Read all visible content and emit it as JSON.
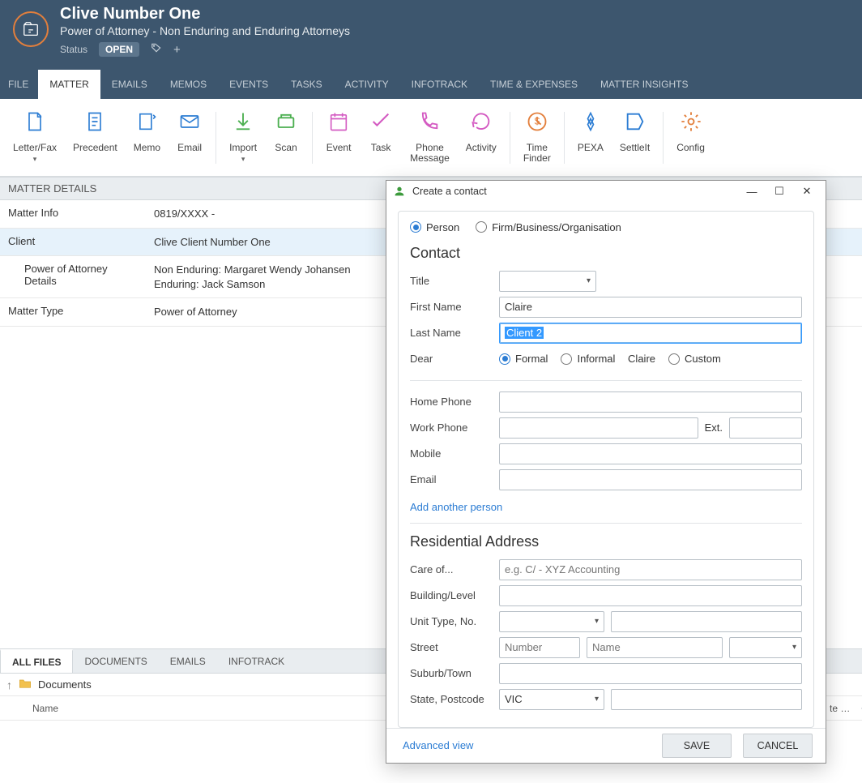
{
  "header": {
    "title": "Clive Number One",
    "subtitle": "Power of Attorney - Non Enduring and Enduring Attorneys",
    "status_label": "Status",
    "status_badge": "OPEN"
  },
  "menu_tabs": [
    "FILE",
    "MATTER",
    "EMAILS",
    "MEMOS",
    "EVENTS",
    "TASKS",
    "ACTIVITY",
    "INFOTRACK",
    "TIME & EXPENSES",
    "MATTER INSIGHTS"
  ],
  "menu_active_index": 1,
  "ribbon": [
    "Letter/Fax",
    "Precedent",
    "Memo",
    "Email",
    "Import",
    "Scan",
    "Event",
    "Task",
    "Phone\nMessage",
    "Activity",
    "Time\nFinder",
    "PEXA",
    "SettleIt",
    "Config"
  ],
  "details_heading": "MATTER DETAILS",
  "details": {
    "rows": [
      {
        "label": "Matter Info",
        "value": "0819/XXXX -",
        "indent": false,
        "selected": false
      },
      {
        "label": "Client",
        "value": "Clive Client Number One",
        "indent": false,
        "selected": true
      },
      {
        "label": "Power of Attorney Details",
        "value": "Non Enduring: Margaret Wendy Johansen\nEnduring: Jack Samson",
        "indent": true,
        "selected": false
      },
      {
        "label": "Matter Type",
        "value": "Power of Attorney",
        "indent": false,
        "selected": false
      }
    ]
  },
  "bottom": {
    "tabs": [
      "ALL FILES",
      "DOCUMENTS",
      "EMAILS",
      "INFOTRACK"
    ],
    "active_index": 0,
    "path": "Documents",
    "col_name": "Name",
    "col_right": "te m..."
  },
  "dialog": {
    "title": "Create a contact",
    "type_options": {
      "person": "Person",
      "firm": "Firm/Business/Organisation"
    },
    "type_selected": "person",
    "contact_heading": "Contact",
    "labels": {
      "title": "Title",
      "first_name": "First Name",
      "last_name": "Last Name",
      "dear": "Dear",
      "home_phone": "Home Phone",
      "work_phone": "Work Phone",
      "ext": "Ext.",
      "mobile": "Mobile",
      "email": "Email",
      "add_person": "Add another person",
      "res_heading": "Residential Address",
      "care_of": "Care of...",
      "building": "Building/Level",
      "unit": "Unit Type, No.",
      "street": "Street",
      "suburb": "Suburb/Town",
      "state": "State, Postcode"
    },
    "values": {
      "title": "",
      "first_name": "Claire",
      "last_name": "Client 2",
      "dear_formal": "Formal",
      "dear_informal": "Informal",
      "dear_informal_value": "Claire",
      "dear_custom": "Custom",
      "dear_selected": "formal",
      "home_phone": "",
      "work_phone": "",
      "ext": "",
      "mobile": "",
      "email": "",
      "care_of": "",
      "care_of_placeholder": "e.g. C/ - XYZ Accounting",
      "building": "",
      "unit_type": "",
      "unit_no": "",
      "street_number": "",
      "street_number_placeholder": "Number",
      "street_name": "",
      "street_name_placeholder": "Name",
      "street_type": "",
      "suburb": "",
      "state": "VIC",
      "postcode": ""
    },
    "footer": {
      "advanced": "Advanced view",
      "save": "SAVE",
      "cancel": "CANCEL"
    }
  }
}
